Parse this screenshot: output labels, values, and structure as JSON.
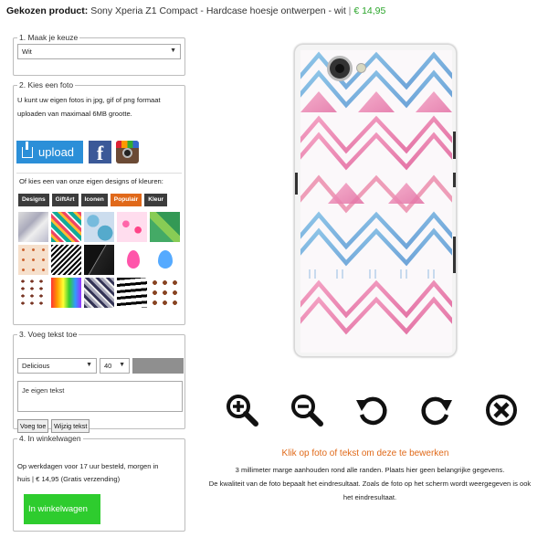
{
  "header": {
    "label": "Gekozen product:",
    "product": "Sony Xperia Z1 Compact - Hardcase hoesje ontwerpen - wit",
    "separator": "|",
    "price": "€ 14,95",
    "price_color": "#2aa52a"
  },
  "step1": {
    "legend": "1. Maak je keuze",
    "select_value": "Wit"
  },
  "step2": {
    "legend": "2. Kies een foto",
    "desc_line1": "U kunt uw eigen fotos in jpg, gif of png formaat",
    "desc_line2": "uploaden van maximaal 6MB grootte.",
    "upload_label": "upload",
    "designs_intro": "Of kies een van onze eigen designs of kleuren:",
    "tabs": [
      "Designs",
      "GiftArt",
      "Iconen",
      "Populair",
      "Kleur"
    ],
    "active_tab": "Populair",
    "accent_color": "#e0691a"
  },
  "step3": {
    "legend": "3. Voeg tekst toe",
    "font_value": "Delicious",
    "size_value": "40",
    "text_placeholder": "Je eigen tekst",
    "add_button": "Voeg toe",
    "edit_button": "Wijzig tekst"
  },
  "step4": {
    "legend": "4. In winkelwagen",
    "line1": "Op werkdagen voor 17 uur besteld, morgen in",
    "line2": "huis | € 14,95 (Gratis verzending)",
    "cart_button": "In winkelwagen",
    "cart_color": "#2ecc2e"
  },
  "editor": {
    "tools": [
      "zoom-in-icon",
      "zoom-out-icon",
      "rotate-left-icon",
      "rotate-right-icon",
      "delete-icon"
    ],
    "click_message": "Klik op foto of tekst om deze te bewerken",
    "info_line1": "3 millimeter marge aanhouden rond alle randen. Plaats hier geen belangrijke gegevens.",
    "info_line2": "De kwaliteit van de foto bepaalt het eindresultaat. Zoals de foto op het scherm wordt weergegeven is ook",
    "info_line3": "het eindresultaat."
  }
}
